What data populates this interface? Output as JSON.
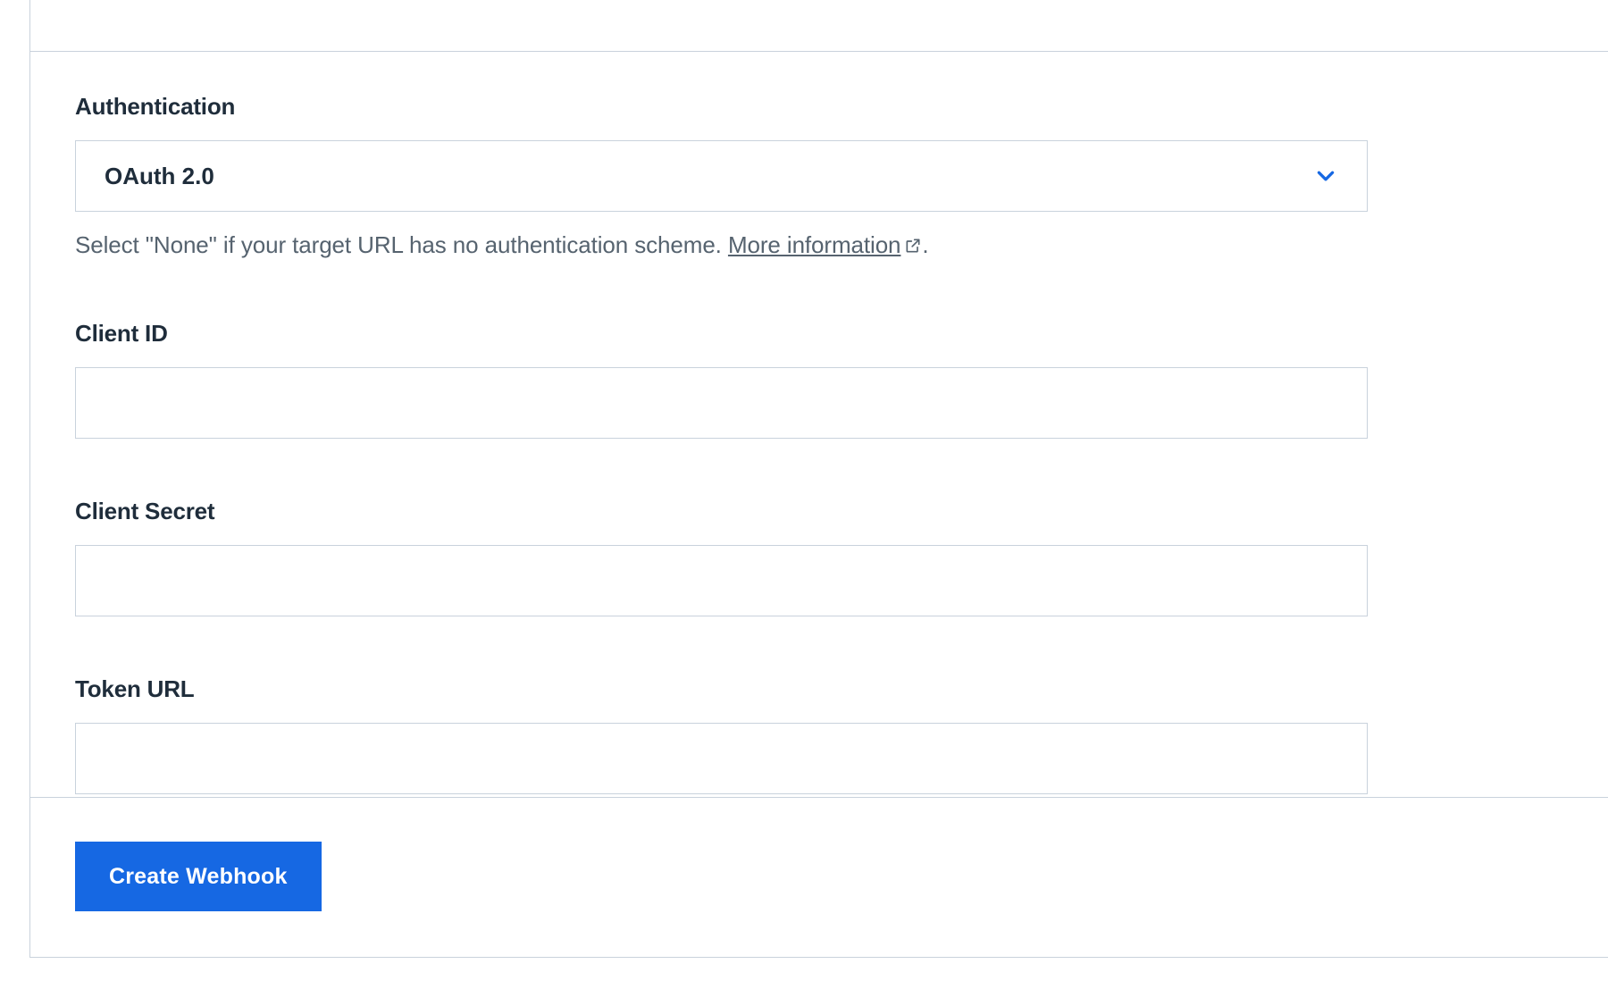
{
  "form": {
    "authentication": {
      "label": "Authentication",
      "selected": "OAuth 2.0",
      "help_prefix": "Select \"None\" if your target URL has no authentication scheme. ",
      "help_link": "More information",
      "help_suffix": "."
    },
    "client_id": {
      "label": "Client ID",
      "value": ""
    },
    "client_secret": {
      "label": "Client Secret",
      "value": ""
    },
    "token_url": {
      "label": "Token URL",
      "value": ""
    }
  },
  "actions": {
    "submit": "Create Webhook"
  },
  "colors": {
    "border": "#c9d2dc",
    "text_primary": "#1f2d3b",
    "text_muted": "#56636f",
    "accent": "#1668e3",
    "white": "#ffffff"
  }
}
